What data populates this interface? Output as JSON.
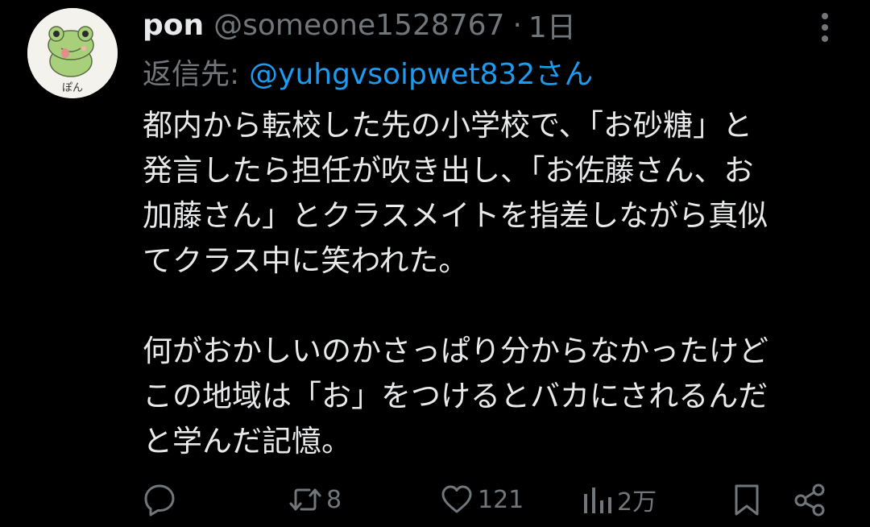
{
  "tweet": {
    "author_name": "pon",
    "author_handle": "@someone1528767",
    "separator": "·",
    "time": "1日",
    "avatar_label": "ぽん",
    "reply_prefix": "返信先:",
    "reply_target": "@yuhgvsoipwet832さん",
    "body_paragraph_1": "都内から転校した先の小学校で、「お砂糖」と\n発言したら担任が吹き出し、「お佐藤さん、お\n加藤さん」とクラスメイトを指差しながら真似\nてクラス中に笑われた。",
    "body_paragraph_2": "何がおかしいのかさっぱり分からなかったけど\nこの地域は「お」をつけるとバカにされるんだ\nと学んだ記憶。"
  },
  "actions": {
    "reply_count": "",
    "retweet_count": "8",
    "like_count": "121",
    "views_count": "2万"
  },
  "icons": {
    "reply": "reply-icon",
    "retweet": "retweet-icon",
    "like": "heart-icon",
    "views": "views-icon",
    "bookmark": "bookmark-icon",
    "share": "share-icon",
    "more": "more-vertical-icon"
  },
  "colors": {
    "background": "#000000",
    "text_primary": "#e7e9ea",
    "text_secondary": "#71767b",
    "link": "#1d9bf0",
    "avatar_frog": "#a8cf7a"
  }
}
